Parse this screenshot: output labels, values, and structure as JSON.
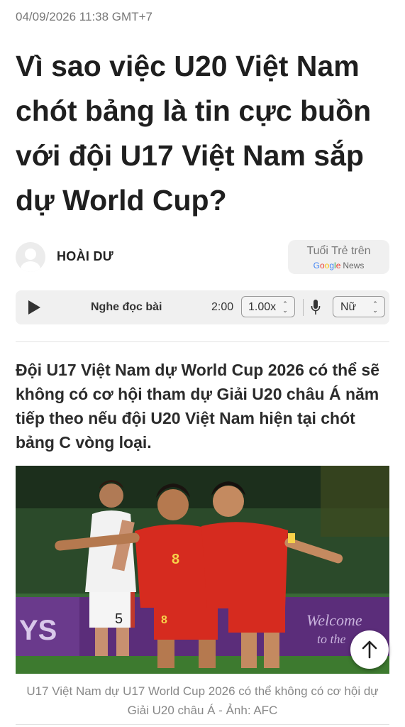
{
  "article": {
    "timestamp": "04/09/2026 11:38 GMT+7",
    "headline": "Vì sao việc U20 Việt Nam chót bảng là tin cực buồn với đội U17 Việt Nam sắp dự World Cup?",
    "author": "HOÀI DƯ",
    "lead": "Đội U17 Việt Nam dự World Cup 2026 có thể sẽ không có cơ hội tham dự Giải U20 châu Á năm tiếp theo nếu đội U20 Việt Nam hiện tại chót bảng C vòng loại.",
    "caption": "U17 Việt Nam dự U17 World Cup 2026 có thể không có cơ hội dự Giải U20 châu Á - Ảnh: AFC"
  },
  "follow_badge": {
    "text": "Tuổi Trẻ trên",
    "google_letters": [
      "G",
      "o",
      "o",
      "g",
      "l",
      "e"
    ],
    "news": "News"
  },
  "audio": {
    "label": "Nghe đọc bài",
    "duration": "2:00",
    "speed": "1.00x",
    "voice": "Nữ"
  },
  "photo": {
    "ad_board_left": "YS",
    "ad_board_right": "Welcome",
    "ad_board_right2": "to the",
    "jersey_1": "8",
    "jersey_2": "8",
    "jersey_opponent": "5"
  },
  "icons": {
    "play": "play-icon",
    "mic": "mic-icon",
    "scroll_top": "arrow-up-icon"
  }
}
